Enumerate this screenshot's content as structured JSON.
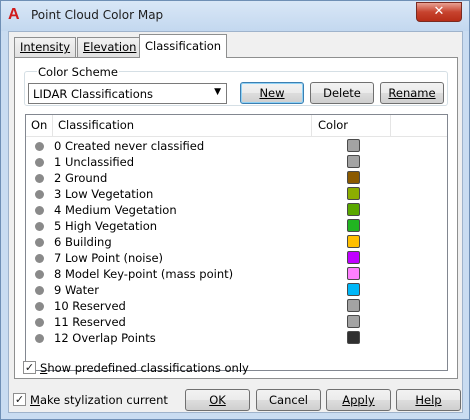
{
  "window": {
    "title": "Point Cloud Color Map",
    "close_glyph": "✕"
  },
  "tabs": [
    {
      "label": "Intensity"
    },
    {
      "label": "Elevation"
    },
    {
      "label": "Classification"
    }
  ],
  "color_scheme": {
    "group_label": "Color Scheme",
    "selected": "LIDAR Classifications",
    "buttons": {
      "new": "New",
      "delete": "Delete",
      "rename": "Rename"
    }
  },
  "table": {
    "columns": [
      "On",
      "Classification",
      "Color"
    ],
    "rows": [
      {
        "label": "0 Created never classified",
        "color": "#a3a3a3"
      },
      {
        "label": "1 Unclassified",
        "color": "#a3a3a3"
      },
      {
        "label": "2 Ground",
        "color": "#8b5a00"
      },
      {
        "label": "3 Low Vegetation",
        "color": "#8cae00"
      },
      {
        "label": "4 Medium Vegetation",
        "color": "#5aa800"
      },
      {
        "label": "5 High Vegetation",
        "color": "#21b521"
      },
      {
        "label": "6 Building",
        "color": "#ffbf00"
      },
      {
        "label": "7 Low Point (noise)",
        "color": "#c000ff"
      },
      {
        "label": "8 Model Key-point (mass point)",
        "color": "#ff80ff"
      },
      {
        "label": "9 Water",
        "color": "#00b7f7"
      },
      {
        "label": "10 Reserved",
        "color": "#a3a3a3"
      },
      {
        "label": "11 Reserved",
        "color": "#a3a3a3"
      },
      {
        "label": "12 Overlap Points",
        "color": "#303030"
      }
    ]
  },
  "show_predefined": {
    "label": "Show predefined classifications only",
    "checked": true
  },
  "make_current": {
    "label": "Make stylization current",
    "checked": true
  },
  "footer": {
    "ok": "OK",
    "cancel": "Cancel",
    "apply": "Apply",
    "help": "Help"
  }
}
